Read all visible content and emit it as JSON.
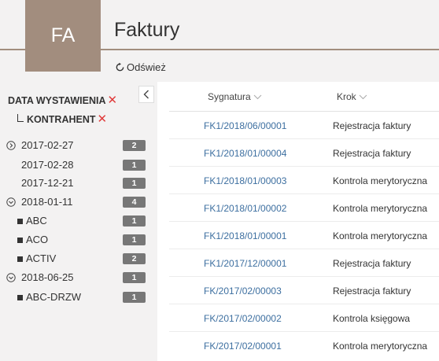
{
  "header": {
    "app_tile": "FA",
    "title": "Faktury",
    "refresh_label": "Odśwież"
  },
  "sidebar": {
    "filters": [
      {
        "label": "DATA WYSTAWIENIA"
      },
      {
        "label": "KONTRAHENT"
      }
    ],
    "tree": [
      {
        "label": "2017-02-27",
        "count": "2",
        "kind": "expandable"
      },
      {
        "label": "2017-02-28",
        "count": "1",
        "kind": "leaf"
      },
      {
        "label": "2017-12-21",
        "count": "1",
        "kind": "leaf"
      },
      {
        "label": "2018-01-11",
        "count": "4",
        "kind": "expanded"
      },
      {
        "label": "ABC",
        "count": "1",
        "kind": "child"
      },
      {
        "label": "ACO",
        "count": "1",
        "kind": "child"
      },
      {
        "label": "ACTIV",
        "count": "2",
        "kind": "child"
      },
      {
        "label": "2018-06-25",
        "count": "1",
        "kind": "expanded"
      },
      {
        "label": "ABC-DRZW",
        "count": "1",
        "kind": "child"
      }
    ]
  },
  "table": {
    "columns": [
      "Sygnatura",
      "Krok"
    ],
    "rows": [
      {
        "sygnatura": "FK1/2018/06/00001",
        "krok": "Rejestracja faktury"
      },
      {
        "sygnatura": "FK1/2018/01/00004",
        "krok": "Rejestracja faktury"
      },
      {
        "sygnatura": "FK1/2018/01/00003",
        "krok": "Kontrola merytoryczna"
      },
      {
        "sygnatura": "FK1/2018/01/00002",
        "krok": "Kontrola merytoryczna"
      },
      {
        "sygnatura": "FK1/2018/01/00001",
        "krok": "Kontrola merytoryczna"
      },
      {
        "sygnatura": "FK1/2017/12/00001",
        "krok": "Rejestracja faktury"
      },
      {
        "sygnatura": "FK/2017/02/00003",
        "krok": "Rejestracja faktury"
      },
      {
        "sygnatura": "FK/2017/02/00002",
        "krok": "Kontrola księgowa"
      },
      {
        "sygnatura": "FK/2017/02/00001",
        "krok": "Kontrola merytoryczna"
      }
    ]
  },
  "icons": {
    "refresh": "refresh-icon",
    "collapse": "chevron-left-icon",
    "remove_filter": "close-icon",
    "sort": "chevron-down-icon"
  },
  "colors": {
    "accent": "#a28d7e",
    "link": "#3d6fa0",
    "badge": "#777777",
    "remove": "#e03a3a"
  }
}
